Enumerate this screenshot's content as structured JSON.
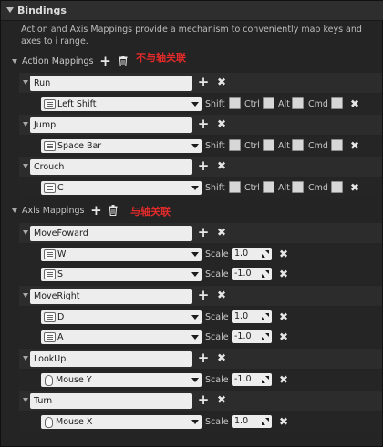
{
  "section": {
    "title": "Bindings"
  },
  "description": "Action and Axis Mappings provide a mechanism to conveniently map keys and axes to input behaviors by inserting a layer of indirection between the input behavior and the keys that invoke it.",
  "description_visible": "Action and Axis Mappings provide a mechanism to conveniently map keys and axes to i range.",
  "action_mappings": {
    "label": "Action Mappings",
    "note": "不与轴关联",
    "items": [
      {
        "name": "Run",
        "key": "Left Shift",
        "mods": [
          "Shift",
          "Ctrl",
          "Alt",
          "Cmd"
        ]
      },
      {
        "name": "Jump",
        "key": "Space Bar",
        "mods": [
          "Shift",
          "Ctrl",
          "Alt",
          "Cmd"
        ]
      },
      {
        "name": "Crouch",
        "key": "C",
        "mods": [
          "Shift",
          "Ctrl",
          "Alt",
          "Cmd"
        ]
      }
    ]
  },
  "axis_mappings": {
    "label": "Axis Mappings",
    "note": "与轴关联",
    "scale_label": "Scale",
    "items": [
      {
        "name": "MoveFoward",
        "keys": [
          {
            "key": "W",
            "scale": "1.0"
          },
          {
            "key": "S",
            "scale": "-1.0"
          }
        ]
      },
      {
        "name": "MoveRight",
        "keys": [
          {
            "key": "D",
            "scale": "1.0"
          },
          {
            "key": "A",
            "scale": "-1.0"
          }
        ]
      },
      {
        "name": "LookUp",
        "keys": [
          {
            "key": "Mouse Y",
            "scale": "-1.0"
          }
        ]
      },
      {
        "name": "Turn",
        "keys": [
          {
            "key": "Mouse X",
            "scale": "1.0"
          }
        ]
      }
    ]
  },
  "colors": {
    "background": "#242424",
    "field": "#ededed",
    "note": "#e22a2a"
  }
}
